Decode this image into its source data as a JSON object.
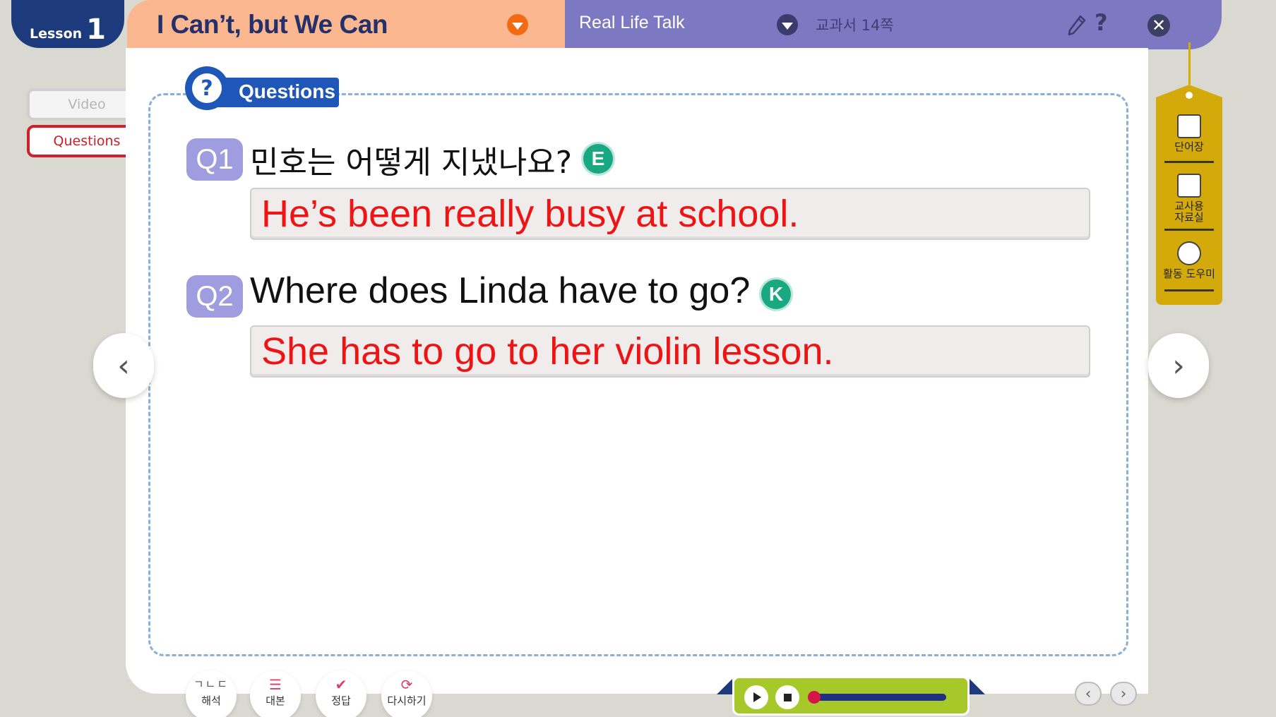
{
  "lesson": {
    "word": "Lesson",
    "number": "1"
  },
  "side_nav": [
    {
      "label": "Video"
    },
    {
      "label": "Questions"
    }
  ],
  "header": {
    "title": "I Can’t, but We Can",
    "subtitle": "Real Life Talk",
    "page_ref": "교과서 14쪽",
    "help": "?",
    "close": "✕"
  },
  "section": {
    "icon": "?",
    "label": "Questions"
  },
  "questions": [
    {
      "num": "Q1",
      "text": "민호는 어떻게 지냈나요?",
      "level": "E",
      "answer": "He’s been really busy at school."
    },
    {
      "num": "Q2",
      "text": "Where does Linda have to go?",
      "level": "K",
      "answer": "She has to go to her violin lesson."
    }
  ],
  "arrows": {
    "prev": "‹",
    "next": "›"
  },
  "toolbox": [
    {
      "label": "단어장"
    },
    {
      "label": "교사용\n자료실"
    },
    {
      "label": "활동 도우미"
    }
  ],
  "bottom_tools": [
    {
      "glyph": "ㄱㄴㄷ",
      "label": "해석"
    },
    {
      "glyph": "☰",
      "label": "대본"
    },
    {
      "glyph": "✔",
      "label": "정답"
    },
    {
      "glyph": "⟳",
      "label": "다시하기"
    }
  ],
  "player": {
    "progress": 0
  },
  "mini_nav": {
    "prev": "‹",
    "next": "›"
  },
  "colors": {
    "lesson_tab": "#1d3b7c",
    "title_bar": "#fbb78f",
    "menu_bar": "#7d78c2",
    "answer_text": "#ee1414",
    "toolbox": "#d4aa0b",
    "player": "#a7c829"
  }
}
